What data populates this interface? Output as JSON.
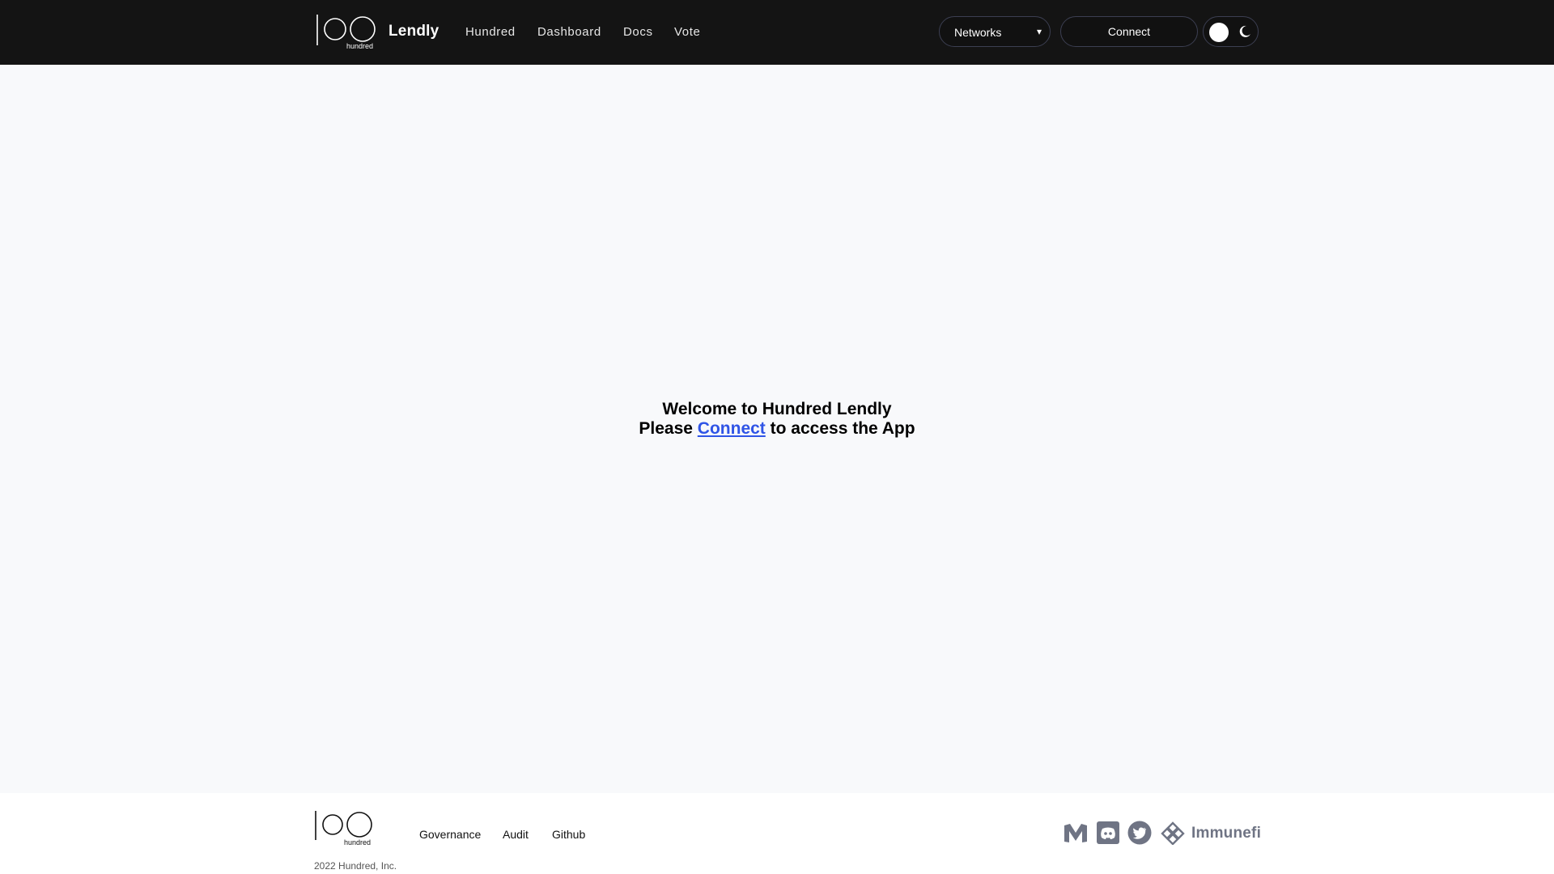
{
  "header": {
    "brand": "Lendly",
    "logo_text": "hundred",
    "nav": [
      {
        "label": "Hundred"
      },
      {
        "label": "Dashboard"
      },
      {
        "label": "Docs"
      },
      {
        "label": "Vote"
      }
    ],
    "networks_label": "Networks",
    "networks_caret": "▾",
    "connect_label": "Connect",
    "theme_icons": [
      "sun-knob",
      "moon-icon"
    ]
  },
  "main": {
    "welcome_line": "Welcome to Hundred Lendly",
    "please": "Please",
    "connect_link": "Connect",
    "access_text": "to access the App"
  },
  "footer": {
    "logo_text": "hundred",
    "links": [
      {
        "label": "Governance"
      },
      {
        "label": "Audit"
      },
      {
        "label": "Github"
      }
    ],
    "copyright": "2022 Hundred, Inc.",
    "social": [
      "medium-icon",
      "discord-icon",
      "twitter-icon",
      "immunefi-icon"
    ],
    "immunefi_label": "Immunefi"
  },
  "colors": {
    "header_bg": "#141414",
    "page_bg": "#f8f9fb",
    "link_blue": "#2f54e6",
    "social_gray": "#6f7484"
  }
}
